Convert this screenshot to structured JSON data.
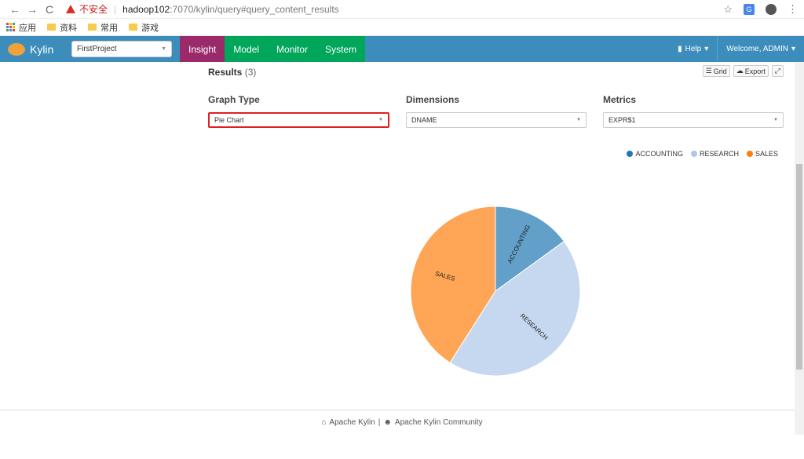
{
  "browser": {
    "back_icon": "←",
    "forward_icon": "→",
    "reload_icon": "C",
    "insecure_label": "不安全",
    "url_host": "hadoop102",
    "url_rest": ":7070/kylin/query#query_content_results",
    "bookmarks": [
      {
        "label": "应用",
        "icon": "apps-grid"
      },
      {
        "label": "资料",
        "icon": "folder"
      },
      {
        "label": "常用",
        "icon": "folder"
      },
      {
        "label": "游戏",
        "icon": "folder"
      }
    ]
  },
  "navbar": {
    "brand": "Kylin",
    "project": "FirstProject",
    "tabs": [
      {
        "label": "Insight",
        "active": true
      },
      {
        "label": "Model",
        "active": false
      },
      {
        "label": "Monitor",
        "active": false
      },
      {
        "label": "System",
        "active": false
      }
    ],
    "help": "Help",
    "welcome": "Welcome, ADMIN"
  },
  "results": {
    "title": "Results",
    "count": "(3)",
    "grid_label": "Grid",
    "export_label": "Export"
  },
  "controls": {
    "graph_type_label": "Graph Type",
    "graph_type_value": "Pie Chart",
    "dimensions_label": "Dimensions",
    "dimensions_value": "DNAME",
    "metrics_label": "Metrics",
    "metrics_value": "EXPR$1"
  },
  "chart_data": {
    "type": "pie",
    "categories": [
      "ACCOUNTING",
      "RESEARCH",
      "SALES"
    ],
    "values": [
      15,
      44,
      41
    ],
    "colors": [
      "#1f77b4",
      "#aec7e8",
      "#ff7f0e"
    ],
    "fill_opacity": 0.7,
    "legend": "top-right"
  },
  "footer": {
    "left": "Apache Kylin",
    "separator": "|",
    "right": "Apache Kylin Community"
  }
}
